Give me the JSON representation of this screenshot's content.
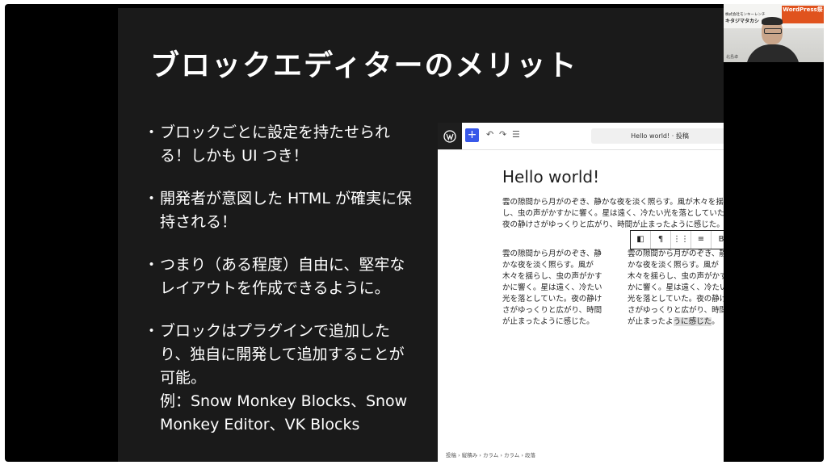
{
  "slide": {
    "title": "ブロックエディターのメリット",
    "bullets": [
      {
        "text": "ブロックごとに設定を持たせられる！しかも UI つき！"
      },
      {
        "text": "開発者が意図した HTML が確実に保持される！"
      },
      {
        "text": " つまり（ある程度）自由に、堅牢なレイアウトを作成できるように。"
      },
      {
        "text": "ブロックはプラグインで追加したり、独自に開発して追加することが可能。",
        "example": "例：Snow Monkey Blocks、Snow Monkey Editor、VK Blocks"
      }
    ],
    "bullet_mark": "・"
  },
  "editor": {
    "doc_title": "Hello world! · 投稿",
    "post_title": "Hello world!",
    "paragraph": "雲の隙間から月がのぞき、静かな夜を淡く照らす。風が木々を揺らし、虫の声がかすかに響く。星は遠く、冷たい光を落としていた。夜の静けさがゆっくりと広がり、時間が止まったように感じた。",
    "column_left": "雲の隙間から月がのぞき、静かな夜を淡く照らす。風が木々を揺らし、虫の声がかすかに響く。星は遠く、冷たい光を落としていた。夜の静けさがゆっくりと広がり、時間が止まったように感じた。",
    "column_right_main": "雲の隙間から月がのぞき、静かな夜を淡く照らす。風が木々を揺らし、虫の声がかすかに響く。星は遠く、冷たい光を落としていた。夜の静けさがゆっくりと広がり、時間が止まったよ",
    "column_right_end": "うに感じた",
    "column_right_tail": "。",
    "breadcrumb": "投稿 › 縦積み › カラム › カラム › 段落",
    "block_toolbar": [
      "◧",
      "¶",
      "⋮⋮",
      "≡",
      "B"
    ],
    "toolbar_icons": {
      "undo": "↶",
      "redo": "↷",
      "list": "☰"
    }
  },
  "webcam": {
    "banner_text": "WordPress祭",
    "company": "株式会社モンキーレンチ",
    "name": "キタジマタカシ",
    "label": "北島卓"
  }
}
